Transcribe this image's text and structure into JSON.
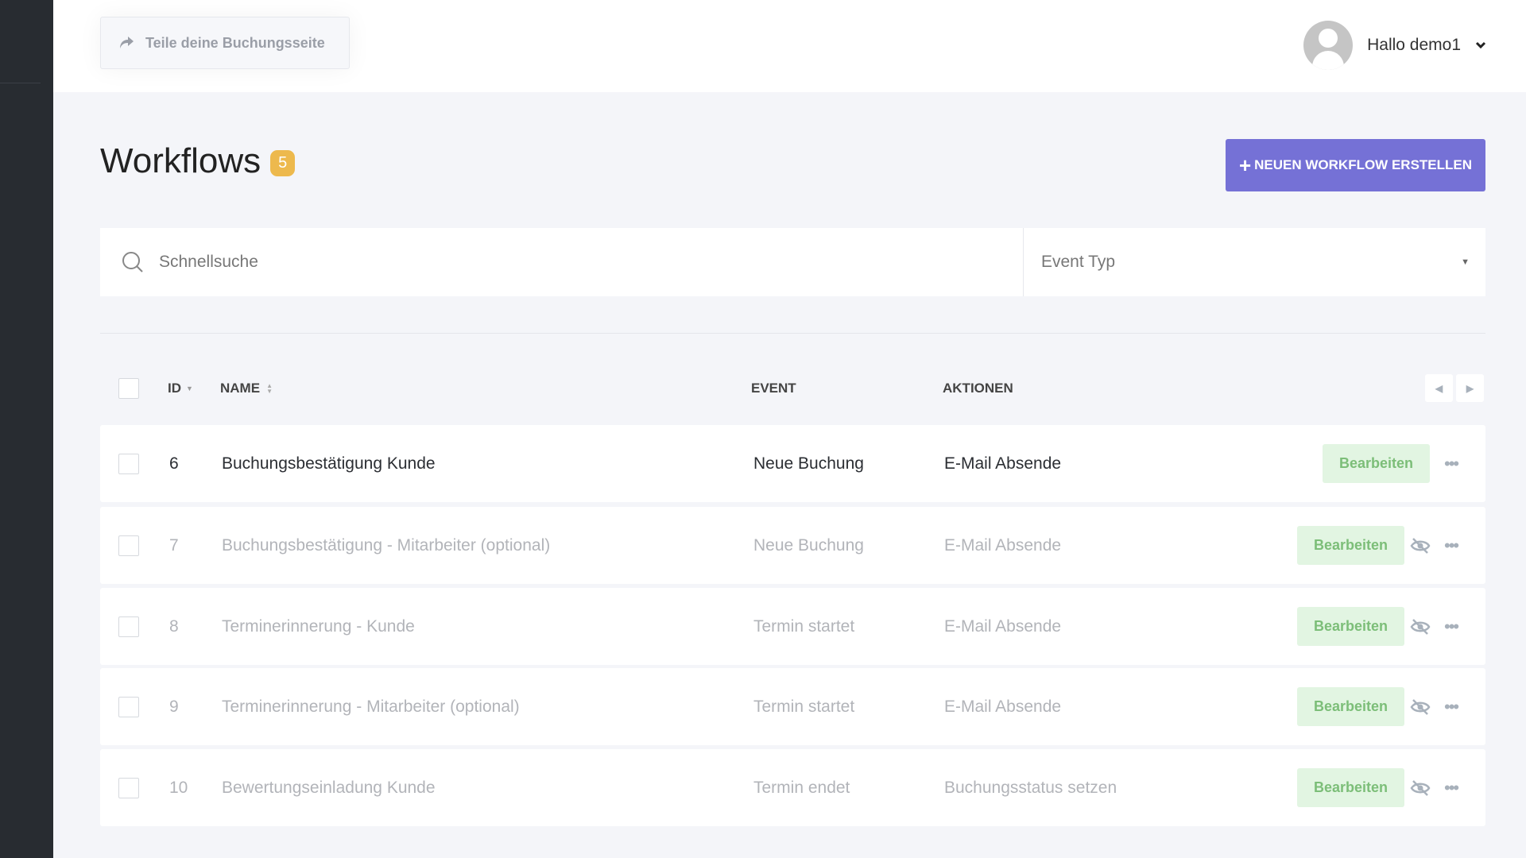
{
  "header": {
    "share_label": "Teile deine Buchungsseite",
    "greeting": "Hallo demo1"
  },
  "page": {
    "title": "Workflows",
    "count": "5",
    "new_button": "NEUEN WORKFLOW ERSTELLEN"
  },
  "filter": {
    "search_placeholder": "Schnellsuche",
    "event_type_placeholder": "Event Typ"
  },
  "table": {
    "columns": {
      "id": "ID",
      "name": "NAME",
      "event": "EVENT",
      "actions": "AKTIONEN"
    },
    "edit_label": "Bearbeiten",
    "rows": [
      {
        "id": "6",
        "name": "Buchungsbestätigung Kunde",
        "event": "Neue Buchung",
        "action": "E-Mail Absende",
        "active": true
      },
      {
        "id": "7",
        "name": "Buchungsbestätigung - Mitarbeiter (optional)",
        "event": "Neue Buchung",
        "action": "E-Mail Absende",
        "active": false
      },
      {
        "id": "8",
        "name": "Terminerinnerung - Kunde",
        "event": "Termin startet",
        "action": "E-Mail Absende",
        "active": false
      },
      {
        "id": "9",
        "name": "Terminerinnerung - Mitarbeiter (optional)",
        "event": "Termin startet",
        "action": "E-Mail Absende",
        "active": false
      },
      {
        "id": "10",
        "name": "Bewertungseinladung Kunde",
        "event": "Termin endet",
        "action": "Buchungsstatus setzen",
        "active": false
      }
    ]
  },
  "colors": {
    "accent": "#7571d6",
    "badge": "#edb94d",
    "edit_bg": "#e2f5e2",
    "edit_text": "#7cbe78",
    "sidebar": "#282c31"
  }
}
